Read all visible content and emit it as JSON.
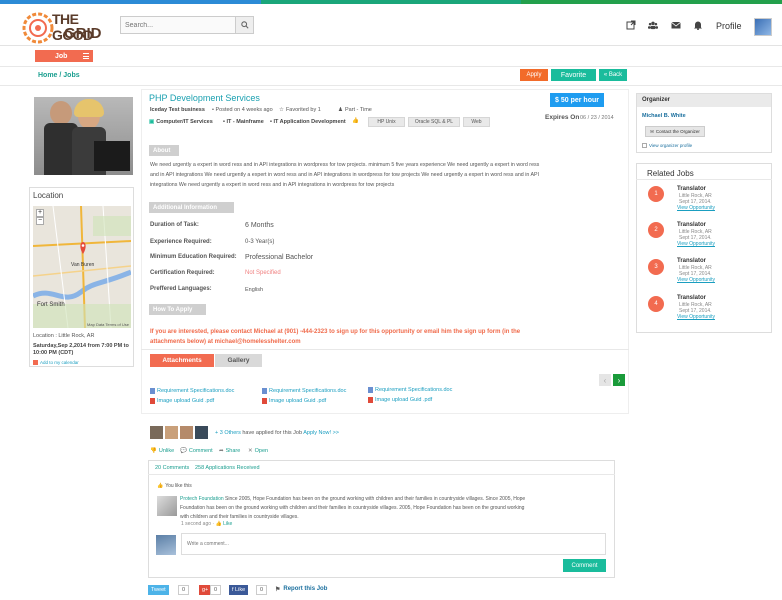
{
  "colors": {
    "accent_orange": "#f26b50",
    "teal": "#1abc9c",
    "link_teal": "#1a9e8f",
    "blue": "#1e9cf0"
  },
  "header": {
    "logo_line1": "THE GOOD",
    "logo_line2": "GRID",
    "search_placeholder": "Search...",
    "icons": [
      "external-link-icon",
      "users-icon",
      "envelope-icon",
      "bell-icon"
    ],
    "profile_label": "Profile"
  },
  "jobbar": {
    "label": "Job"
  },
  "breadcrumb": "Home / Jobs",
  "top_actions": {
    "apply": "Apply",
    "favorite": "Favorite",
    "back": "« Back"
  },
  "job": {
    "title": "PHP Development Services",
    "company": "Iceday Test business",
    "posted": "Posted on 4 weeks ago",
    "favorited": "Favorited by 1",
    "type": "Part - Time",
    "category": "Computer/IT Services",
    "subcategory1": "IT - Mainframe",
    "subcategory2": "IT Application Development",
    "tags": [
      "HP Unix",
      "Oracle SQL & PL",
      "Web"
    ],
    "salary": "$ 50 per hour",
    "expires_label": "Expires On",
    "expires_date": "06 / 23 / 2014"
  },
  "about": {
    "heading": "About",
    "text": "We need urgently a expert in word ress and in API integrations in wordpress for tow projects. minimum 5 five years experience We need urgently a expert in word ress and in API integrations We need urgently a expert in word ress and in API integrations in wordpress for tow projects We need urgently a expert in word ress and in API integrations We need urgently a expert in word ress and in API integrations in wordpress for tow projects"
  },
  "additional": {
    "heading": "Additional Information",
    "rows": [
      {
        "label": "Duration of Task:",
        "value": "6 Months"
      },
      {
        "label": "Experience Required:",
        "value": "0-3 Year(s)"
      },
      {
        "label": "Minimum  Education Required:",
        "value": "Professional Bachelor"
      },
      {
        "label": "Certification Required:",
        "value": "Not Specified"
      },
      {
        "label": "Preffered Languages:",
        "value": "English"
      }
    ]
  },
  "howto": {
    "heading": "How To Apply",
    "text": "If you are interested, please contact Michael at (901) -444-2323 to sign up for this opportunity or email him the sign up form (in the attachments below) at michael@homelesshelter.com"
  },
  "tabs": {
    "attachments": "Attachments",
    "gallery": "Gallery"
  },
  "attachments": [
    {
      "name": "Requirement Specifications.doc",
      "type": "doc"
    },
    {
      "name": "Image upload Guid .pdf",
      "type": "pdf"
    },
    {
      "name": "Requirement Specifications.doc",
      "type": "doc"
    },
    {
      "name": "Image upload Guid .pdf",
      "type": "pdf"
    },
    {
      "name": "Requirement Specifications.doc",
      "type": "doc"
    },
    {
      "name": "Image upload Guid .pdf",
      "type": "pdf"
    }
  ],
  "applied": {
    "others_link": "+ 3 Others",
    "text": "have applied for this Job",
    "apply_now": "Apply Now! >>"
  },
  "actions": {
    "unlike": "Unlike",
    "comment": "Comment",
    "share": "Share",
    "open": "Open"
  },
  "comments": {
    "count_label": "20 Comments",
    "applications_label": "258 Applications Received",
    "you_like": "You like this",
    "author": "Protech Foundation",
    "text": "Since 2005, Hope Foundation has been on the ground working with children and their families in countryside villages. Since 2005, Hope Foundation has been on the ground working with children and their families in countryside villages. 2005, Hope Foundation has been on the ground working with children and their families in countryside villages.",
    "time": "1 second ago",
    "like": "Like",
    "write_placeholder": "Write a comment...",
    "submit": "Comment"
  },
  "location": {
    "heading": "Location",
    "address": "Location : Little Rock, AR",
    "datetime": "Saturday,Sep 2,2014 from 7:00 PM to 10:00 PM (CDT)",
    "calendar": "Add to my calendar",
    "map_label_city": "Van Buren",
    "map_label_city2": "Fort Smith",
    "map_credit": "Map Data  Terms of Use"
  },
  "organizer": {
    "heading": "Organizer",
    "name": "Michael B. White",
    "contact": "Contact the Organizer",
    "view": "View organizer profile"
  },
  "related": {
    "heading": "Related Jobs",
    "items": [
      {
        "num": "1",
        "title": "Translator",
        "city": "Little Rock, AR",
        "date": "Sept 17, 2014.",
        "link": "View Opportunity"
      },
      {
        "num": "2",
        "title": "Translator",
        "city": "Little Rock, AR",
        "date": "Sept 17, 2014.",
        "link": "View Opportunity"
      },
      {
        "num": "3",
        "title": "Translator",
        "city": "Little Rock, AR",
        "date": "Sept 17, 2014.",
        "link": "View Opportunity"
      },
      {
        "num": "4",
        "title": "Translator",
        "city": "Little Rock, AR",
        "date": "Sept 17, 2014.",
        "link": "View Opportunity"
      }
    ]
  },
  "social": {
    "tweet": "Tweet",
    "tweet_count": "0",
    "gplus": "g+",
    "gplus_count": "0",
    "fb_like": "f Like",
    "fb_count": "0",
    "report": "Report this Job"
  }
}
